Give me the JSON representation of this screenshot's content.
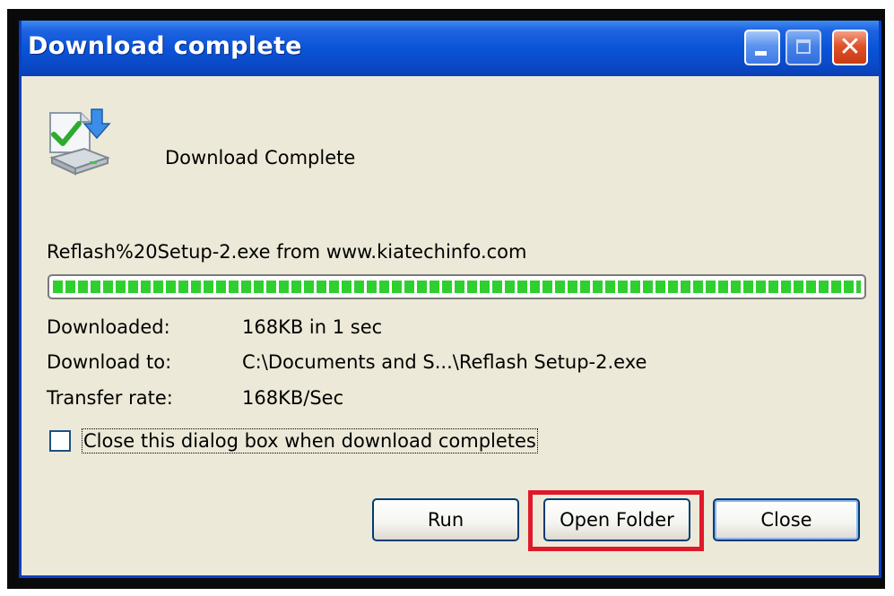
{
  "window": {
    "title": "Download complete"
  },
  "title_buttons": {
    "minimize_icon": "minimize-icon",
    "maximize_icon": "maximize-icon",
    "close_icon": "close-icon",
    "close_glyph": "✕"
  },
  "dialog": {
    "heading": "Download Complete",
    "icon": "download-complete-icon",
    "source": "Reflash%20Setup-2.exe from www.kiatechinfo.com",
    "progress_fraction": 1.0,
    "progress_color": "#2fcf2f",
    "info": [
      {
        "label": "Downloaded:",
        "value": "168KB in 1 sec"
      },
      {
        "label": "Download to:",
        "value": "C:\\Documents and S...\\Reflash Setup-2.exe"
      },
      {
        "label": "Transfer rate:",
        "value": "168KB/Sec"
      }
    ],
    "close_when_complete": {
      "checked": false,
      "label": "Close this dialog box when download completes"
    }
  },
  "buttons": {
    "run": "Run",
    "open_folder": "Open Folder",
    "close": "Close"
  },
  "highlight_color": "#e0192a"
}
